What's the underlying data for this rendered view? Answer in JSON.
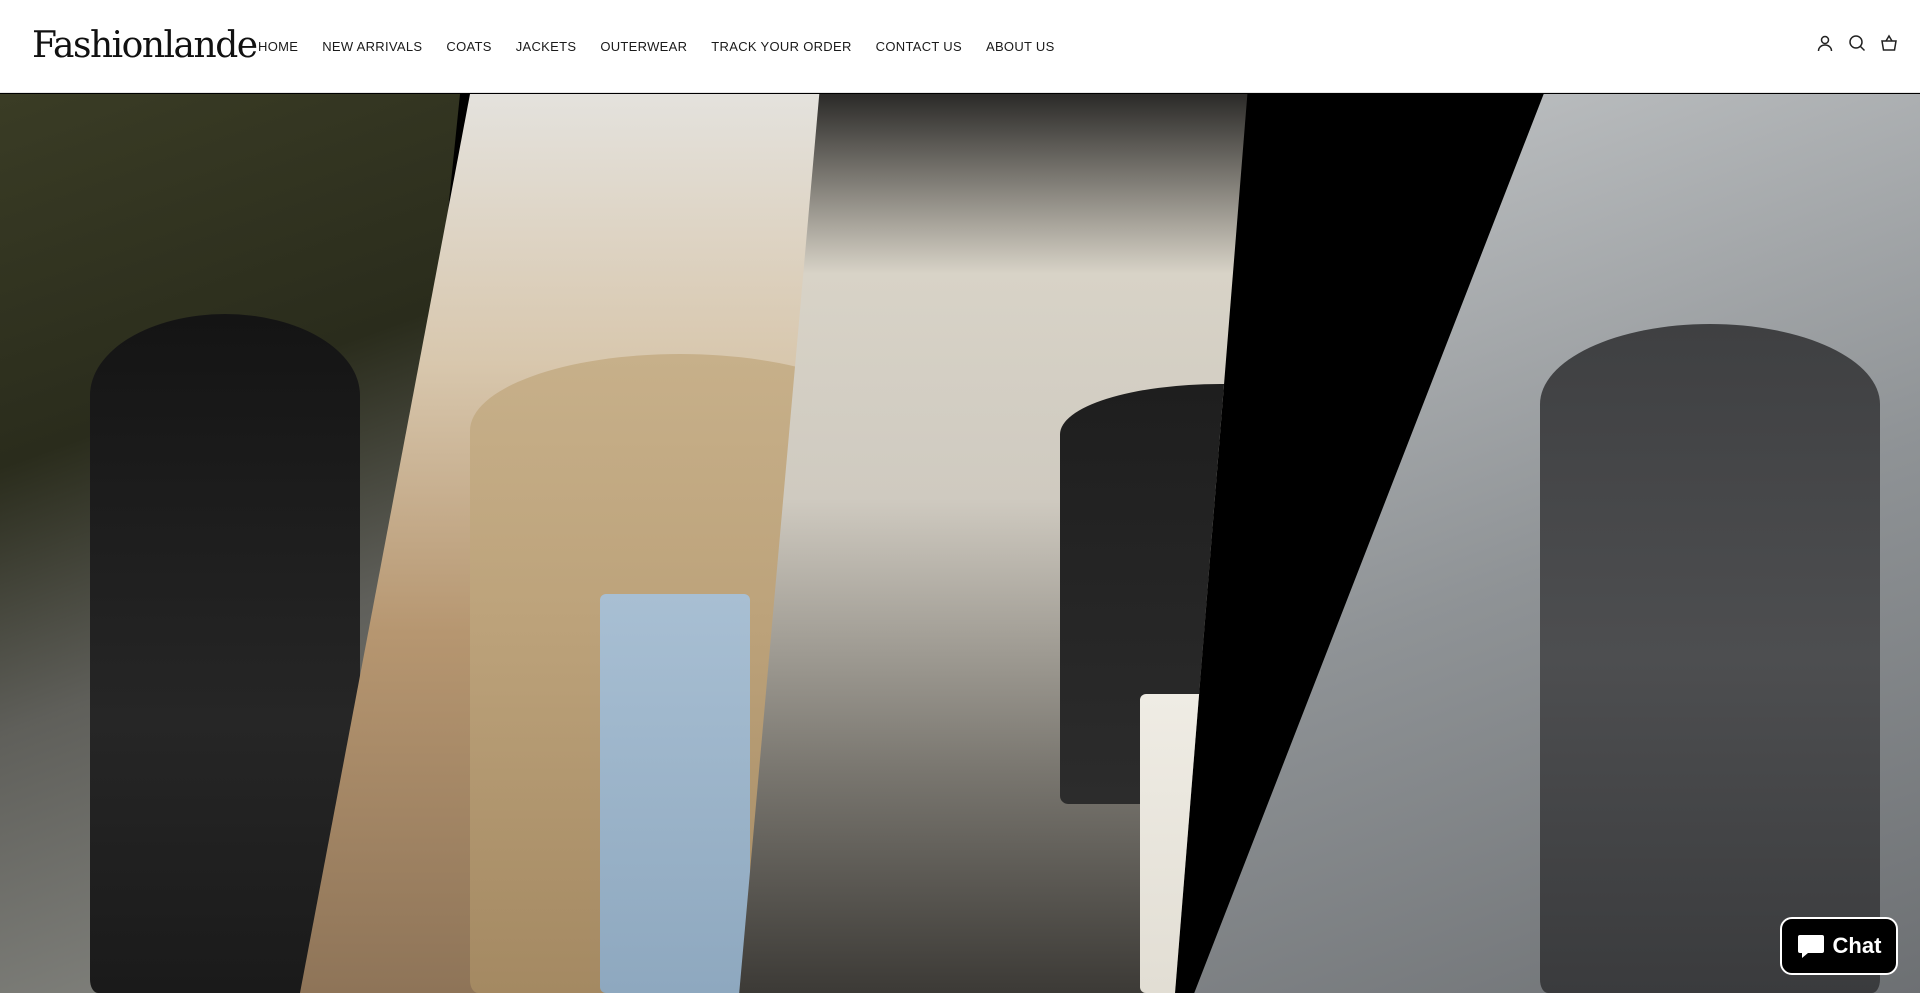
{
  "brand": {
    "logo_text": "Fashionlande"
  },
  "nav": {
    "items": [
      {
        "label": "HOME"
      },
      {
        "label": "NEW ARRIVALS"
      },
      {
        "label": "COATS"
      },
      {
        "label": "JACKETS"
      },
      {
        "label": "OUTERWEAR"
      },
      {
        "label": "TRACK YOUR ORDER"
      },
      {
        "label": "CONTACT US"
      },
      {
        "label": "ABOUT US"
      }
    ]
  },
  "header_icons": [
    "account-icon",
    "search-icon",
    "cart-icon"
  ],
  "hero": {
    "panels": [
      {
        "name": "black-leather-coat-look"
      },
      {
        "name": "trench-coat-look"
      },
      {
        "name": "charcoal-wrap-look"
      },
      {
        "name": "grey-wool-coat-look"
      }
    ]
  },
  "chat_widget": {
    "label": "Chat",
    "icon": "chat-bubble-icon"
  },
  "colors": {
    "header_bg": "#ffffff",
    "text": "#1a1a1a",
    "chat_bg": "#000000"
  }
}
